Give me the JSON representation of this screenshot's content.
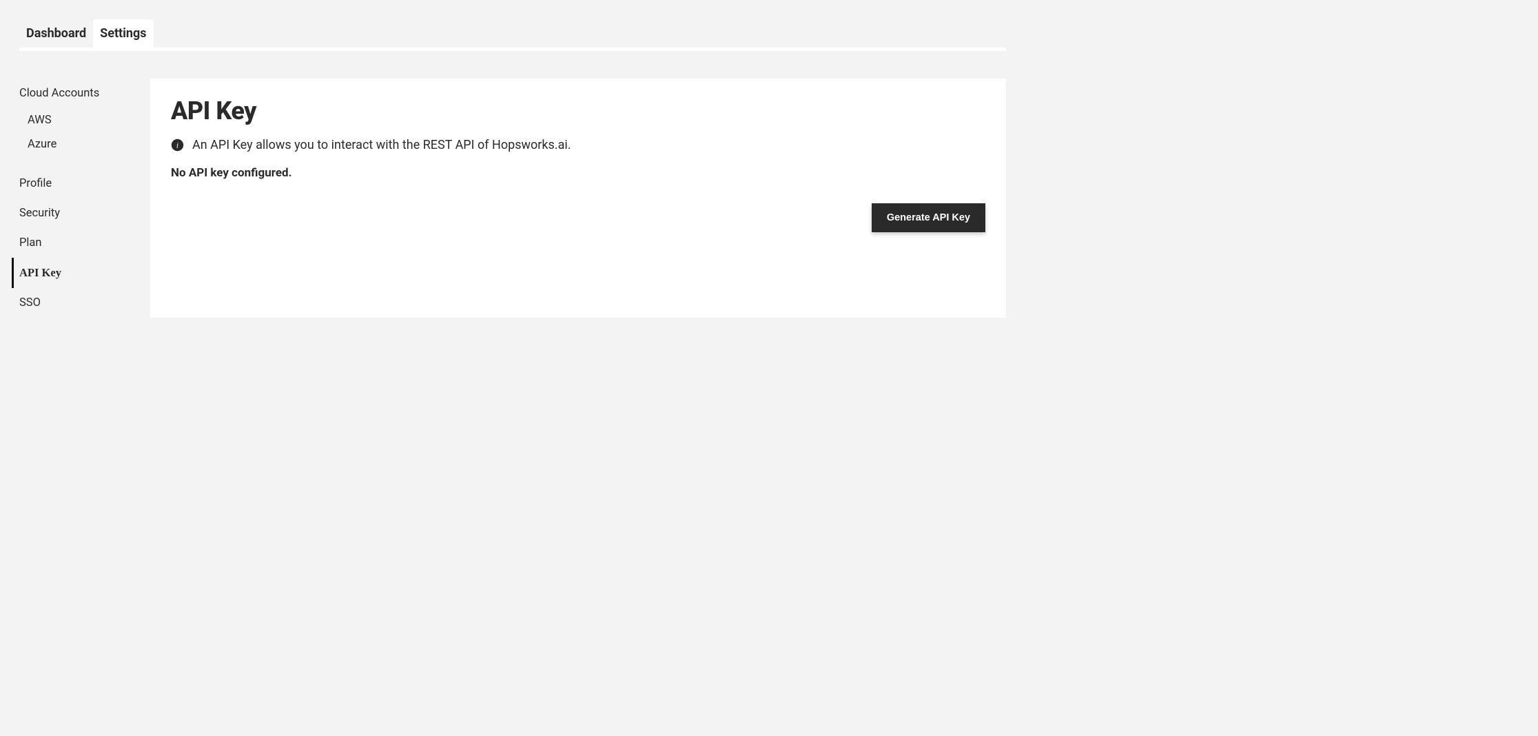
{
  "tabs": {
    "dashboard": "Dashboard",
    "settings": "Settings"
  },
  "sidebar": {
    "cloud_accounts": "Cloud Accounts",
    "aws": "AWS",
    "azure": "Azure",
    "profile": "Profile",
    "security": "Security",
    "plan": "Plan",
    "api_key": "API Key",
    "sso": "SSO"
  },
  "main": {
    "title": "API Key",
    "info": "An API Key allows you to interact with the REST API of Hopsworks.ai.",
    "status": "No API key configured.",
    "generate_button": "Generate API Key"
  }
}
